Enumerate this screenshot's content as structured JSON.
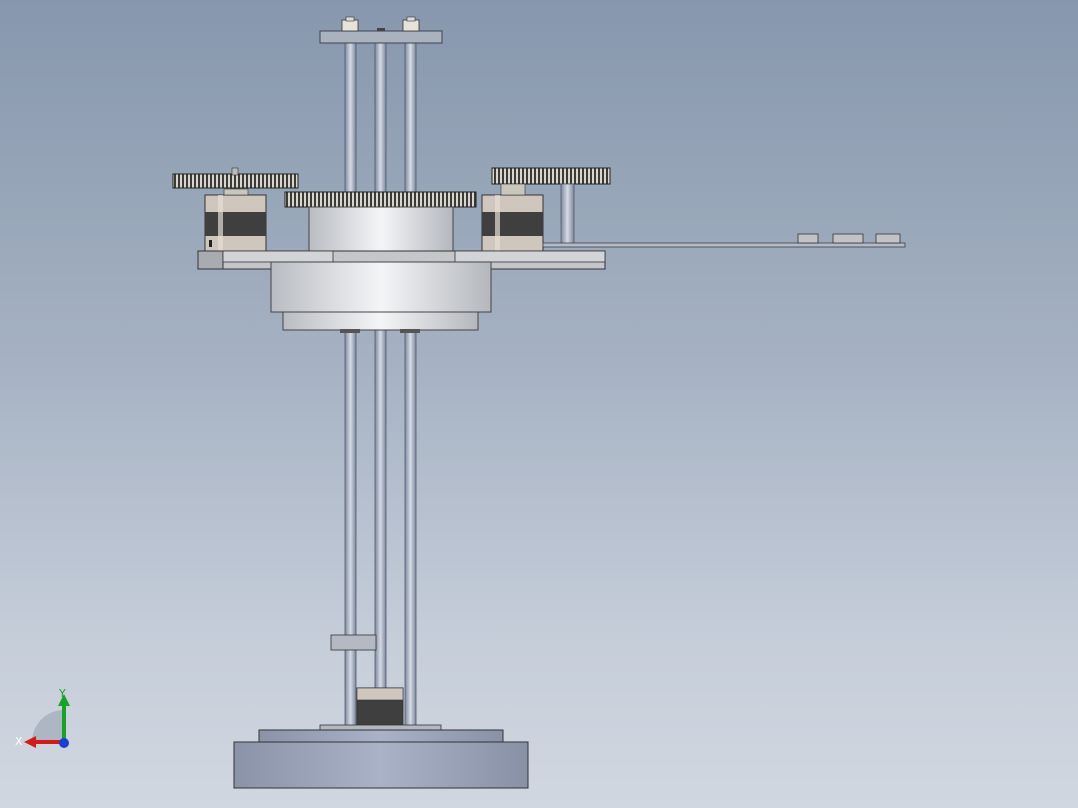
{
  "viewport": {
    "background_top": "#8797ad",
    "background_bottom": "#d1d7e0"
  },
  "model": {
    "parts": [
      "top-plate",
      "guide-rods",
      "left-gear",
      "center-gear",
      "right-gear",
      "left-stepper-motor",
      "right-stepper-motor",
      "mounting-plate",
      "turntable-hub",
      "side-arm",
      "arm-nuts",
      "bottom-stepper-motor",
      "base-plate",
      "base-cylinder"
    ]
  },
  "triad": {
    "x_label": "X",
    "y_label": "Y",
    "x_color": "#d21c1c",
    "y_color": "#19a12a",
    "z_color": "#1c3fd2"
  }
}
